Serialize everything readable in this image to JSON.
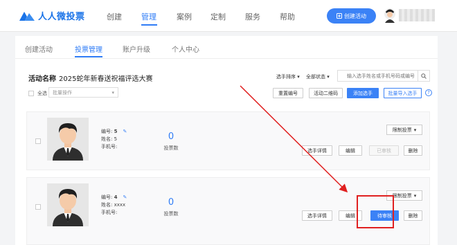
{
  "brand": {
    "name": "人人微投票",
    "accent": "#2f7cf6"
  },
  "nav": {
    "items": [
      "创建",
      "管理",
      "案例",
      "定制",
      "服务",
      "帮助"
    ],
    "active": "管理"
  },
  "header": {
    "create_button": "创建活动"
  },
  "tabs": {
    "items": [
      "创建活动",
      "投票管理",
      "账户升级",
      "个人中心"
    ],
    "active": "投票管理"
  },
  "activity": {
    "label": "活动名称",
    "name": "2025蛇年新春送祝福评选大赛"
  },
  "filters": {
    "sort_label": "选手排序",
    "status_label": "全部状态",
    "search_placeholder": "输入选手姓名或手机号码或编号"
  },
  "toolbar": {
    "select_all": "全选",
    "batch_placeholder": "批量操作",
    "reset_ids": "重置编号",
    "activity_qr": "活动二维码",
    "add_contestant": "添加选手",
    "batch_import": "批量导入选手",
    "help": "?"
  },
  "contestants": [
    {
      "id_label": "编号:",
      "id": "5",
      "name_label": "姓名:",
      "name": "5",
      "phone_label": "手机号:",
      "phone": "",
      "votes": "0",
      "votes_label": "投票数",
      "limit": "限制投票",
      "actions": {
        "detail": "选手详情",
        "edit": "编辑",
        "review": "已审核",
        "delete": "删除"
      },
      "reviewed": true
    },
    {
      "id_label": "编号:",
      "id": "4",
      "name_label": "姓名:",
      "name": "xxxx",
      "phone_label": "手机号:",
      "phone": "",
      "votes": "0",
      "votes_label": "投票数",
      "limit": "限制投票",
      "actions": {
        "detail": "选手详情",
        "edit": "编辑",
        "review": "待审核",
        "delete": "删除"
      },
      "reviewed": false
    }
  ],
  "colors": {
    "primary": "#3b82f6",
    "annotation": "#e02020"
  }
}
